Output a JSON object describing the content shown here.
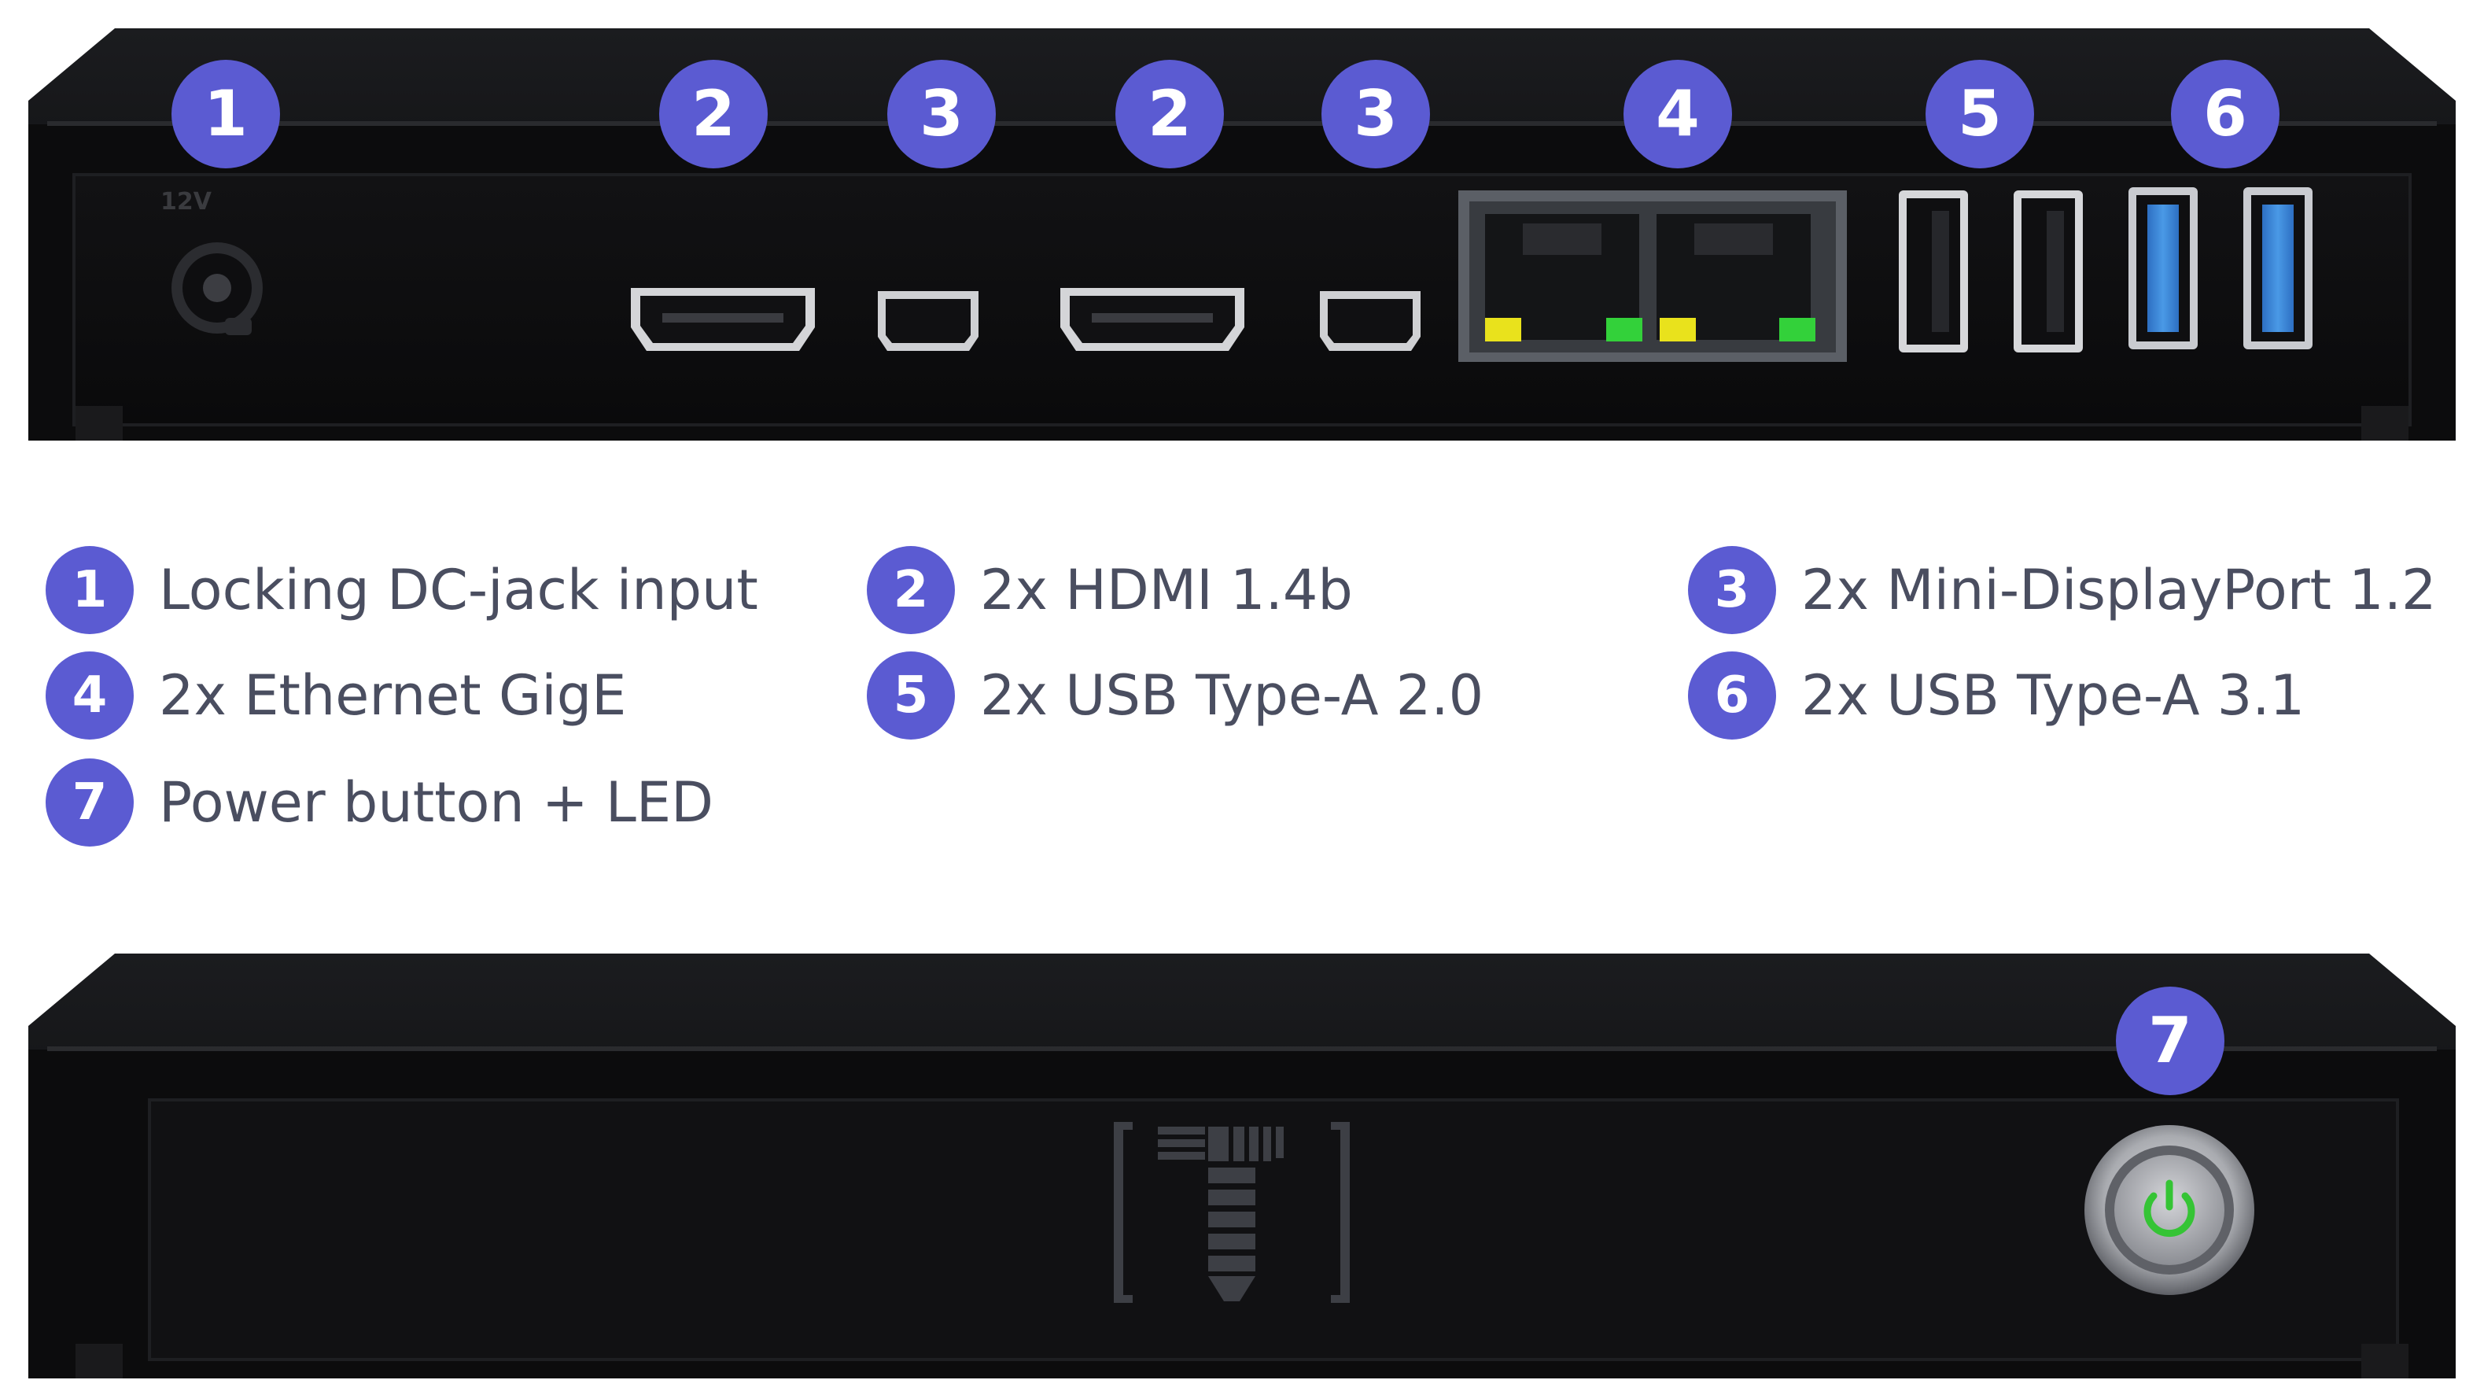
{
  "markers": {
    "rear": [
      "1",
      "2",
      "3",
      "2",
      "3",
      "4",
      "5",
      "6"
    ],
    "front": [
      "7"
    ]
  },
  "port_labels": {
    "dc_jack": "12V"
  },
  "legend": [
    {
      "num": "1",
      "label": "Locking DC-jack input"
    },
    {
      "num": "2",
      "label": "2x HDMI 1.4b"
    },
    {
      "num": "3",
      "label": "2x Mini-DisplayPort 1.2"
    },
    {
      "num": "4",
      "label": "2x Ethernet GigE"
    },
    {
      "num": "5",
      "label": "2x USB Type-A 2.0"
    },
    {
      "num": "6",
      "label": "2x USB Type-A 3.1"
    },
    {
      "num": "7",
      "label": "Power button + LED"
    }
  ],
  "colors": {
    "marker": "#5b5bd2",
    "legend_text": "#4a4e60",
    "enclosure": "#0b0b0c",
    "usb3_blue": "#3a86d8",
    "led_green": "#33d13a",
    "led_yellow": "#e9e21c",
    "power_led": "#35c435"
  },
  "icons": {
    "power_button": "power-icon",
    "logo": "bracket-t-logo"
  }
}
